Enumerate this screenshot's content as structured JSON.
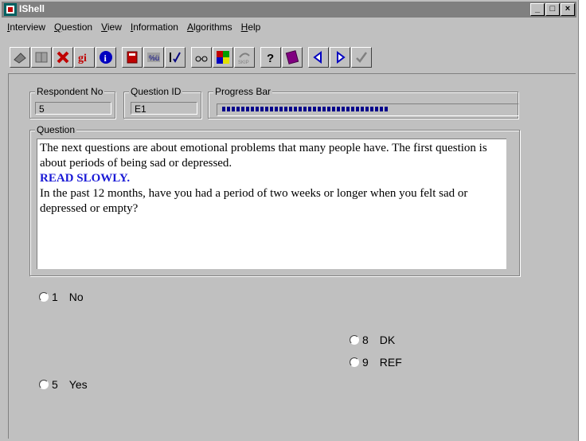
{
  "window": {
    "title": "IShell"
  },
  "menu": [
    {
      "label": "Interview"
    },
    {
      "label": "Question"
    },
    {
      "label": "View"
    },
    {
      "label": "Information"
    },
    {
      "label": "Algorithms"
    },
    {
      "label": "Help"
    }
  ],
  "toolbar": [
    {
      "name": "eraser-icon"
    },
    {
      "name": "book-icon"
    },
    {
      "name": "delete-icon"
    },
    {
      "name": "gi-icon",
      "text": "gi"
    },
    {
      "name": "info-icon"
    },
    {
      "name": "notebook-icon"
    },
    {
      "name": "keyboard-icon"
    },
    {
      "name": "checklist-icon"
    },
    {
      "name": "glasses-icon"
    },
    {
      "name": "color-squares-icon"
    },
    {
      "name": "skip-icon",
      "text": "SKIP"
    },
    {
      "name": "help-question-icon"
    },
    {
      "name": "help-book-icon"
    },
    {
      "name": "previous-icon"
    },
    {
      "name": "next-icon"
    },
    {
      "name": "checkmark-icon"
    }
  ],
  "respondent": {
    "label": "Respondent No",
    "value": "5"
  },
  "question_id": {
    "label": "Question ID",
    "value": "E1"
  },
  "progress": {
    "label": "Progress Bar",
    "fraction": 0.57
  },
  "question": {
    "label": "Question",
    "line1": "The next questions are about emotional problems that many people have. The first question is about periods of being sad or depressed.",
    "emphasis": "READ SLOWLY.",
    "line2": "In the past 12 months, have you had a period of two weeks or longer when you felt sad or depressed or empty?"
  },
  "options": [
    {
      "code": "1",
      "label": "No"
    },
    {
      "code": "8",
      "label": "DK"
    },
    {
      "code": "9",
      "label": "REF"
    },
    {
      "code": "5",
      "label": "Yes"
    }
  ],
  "colors": {
    "titlebar": "#808080",
    "face": "#c0c0c0",
    "progress": "#00008b",
    "emphasis": "#1a1ad6"
  }
}
